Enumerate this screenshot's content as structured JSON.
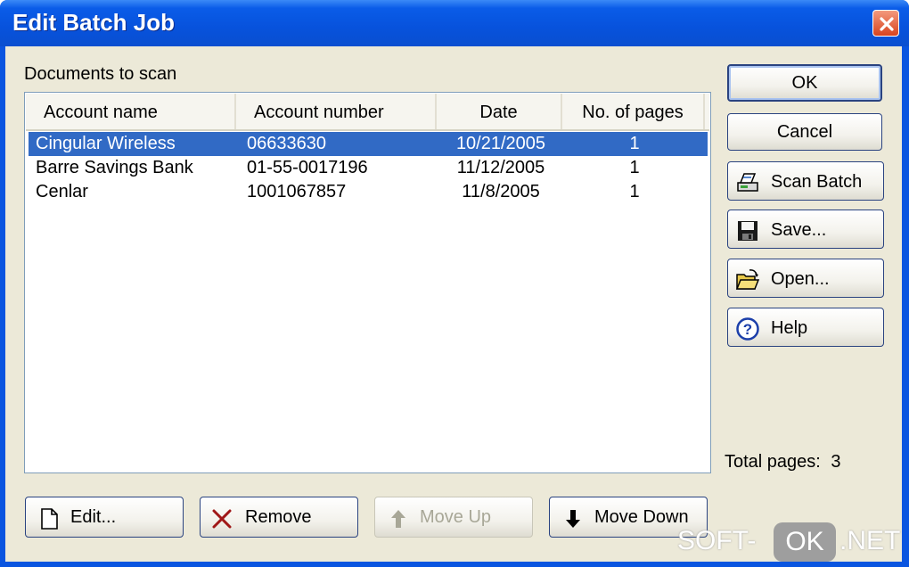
{
  "window": {
    "title": "Edit Batch Job"
  },
  "documents_label": "Documents to scan",
  "table": {
    "columns": [
      "Account name",
      "Account number",
      "Date",
      "No. of pages"
    ],
    "rows": [
      {
        "account_name": "Cingular Wireless",
        "account_number": "06633630",
        "date": "10/21/2005",
        "pages": "1",
        "selected": true
      },
      {
        "account_name": "Barre Savings Bank",
        "account_number": "01-55-0017196",
        "date": "11/12/2005",
        "pages": "1",
        "selected": false
      },
      {
        "account_name": "Cenlar",
        "account_number": "1001067857",
        "date": "11/8/2005",
        "pages": "1",
        "selected": false
      }
    ]
  },
  "side_buttons": {
    "ok": "OK",
    "cancel": "Cancel",
    "scan_batch": "Scan Batch",
    "save": "Save...",
    "open": "Open...",
    "help": "Help"
  },
  "bottom_buttons": {
    "edit": "Edit...",
    "remove": "Remove",
    "move_up": "Move Up",
    "move_down": "Move Down"
  },
  "total_pages": {
    "label": "Total pages:",
    "value": "3"
  },
  "watermark": {
    "left": "SOFT-",
    "middle": "OK",
    "right": ".NET"
  },
  "colors": {
    "titlebar": "#0a5ce8",
    "selection": "#316ac5",
    "dialog_bg": "#ece9d8",
    "close": "#d8431e"
  },
  "icons": [
    "close-icon",
    "scanner-icon",
    "floppy-disk-icon",
    "open-folder-icon",
    "help-icon",
    "document-icon",
    "x-icon",
    "arrow-up-icon",
    "arrow-down-icon"
  ]
}
